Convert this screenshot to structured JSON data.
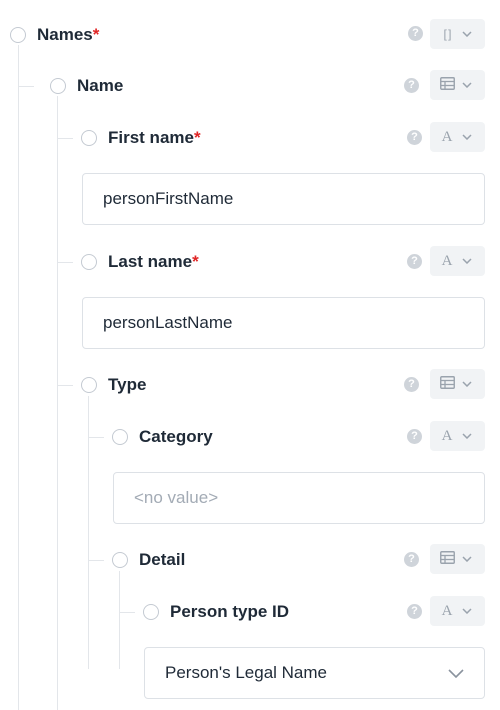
{
  "tree": {
    "names": {
      "label": "Names",
      "required_mark": "*",
      "type_icon": "array-icon"
    },
    "name": {
      "label": "Name",
      "type_icon": "table-icon"
    },
    "first_name": {
      "label": "First name",
      "required_mark": "*",
      "type_icon": "text-icon",
      "value": "personFirstName"
    },
    "last_name": {
      "label": "Last name",
      "required_mark": "*",
      "type_icon": "text-icon",
      "value": "personLastName"
    },
    "type": {
      "label": "Type",
      "type_icon": "table-icon"
    },
    "category": {
      "label": "Category",
      "type_icon": "text-icon",
      "placeholder": "<no value>"
    },
    "detail": {
      "label": "Detail",
      "type_icon": "table-icon"
    },
    "person_type_id": {
      "label": "Person type ID",
      "type_icon": "text-icon",
      "selected_value": "Person's Legal Name"
    }
  },
  "icons": {
    "help_glyph": "?",
    "array_glyph": "[ ]",
    "text_glyph": "A"
  },
  "colors": {
    "required": "#e02424",
    "tree_line": "#e3e6ea",
    "icon_gray": "#9aa3ad",
    "type_button_bg": "#f1f3f5"
  }
}
